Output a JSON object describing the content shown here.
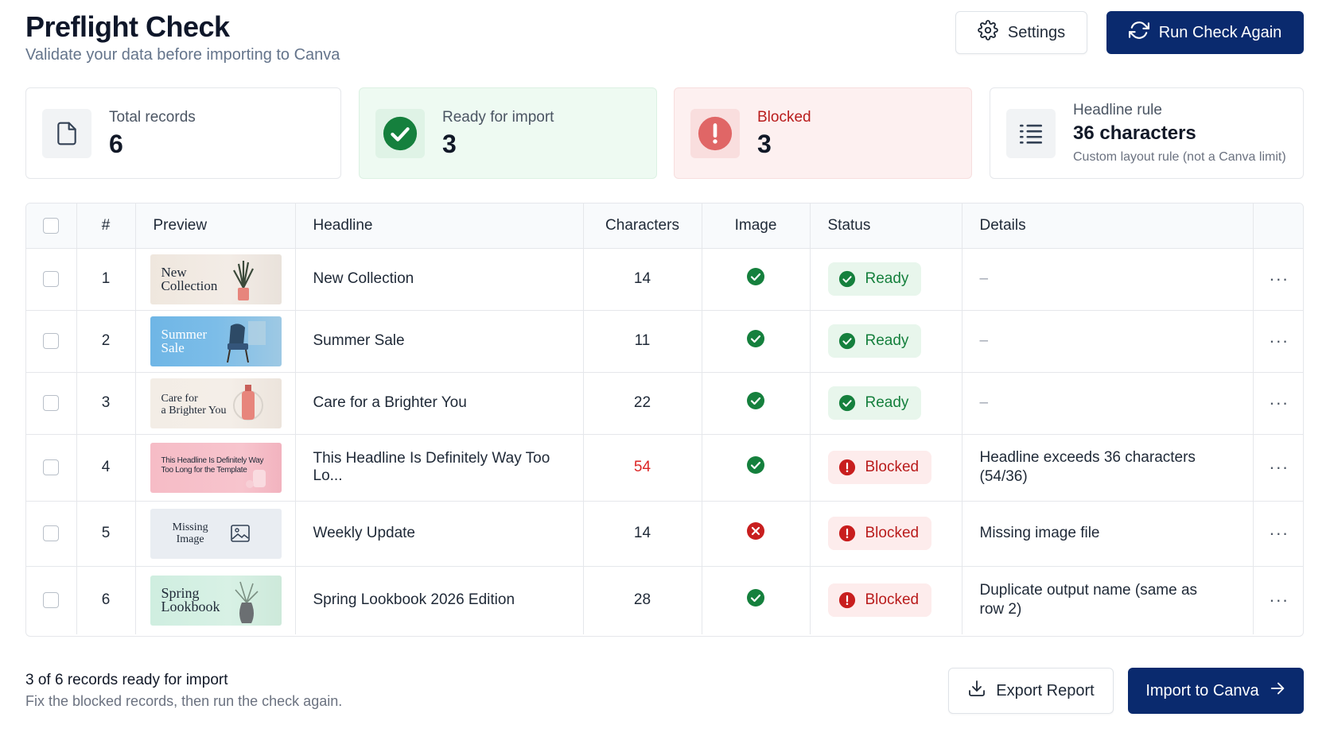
{
  "header": {
    "title": "Preflight Check",
    "subtitle": "Validate your data before importing to Canva",
    "settings_label": "Settings",
    "run_label": "Run Check Again"
  },
  "cards": {
    "total": {
      "label": "Total records",
      "value": "6"
    },
    "ready": {
      "label": "Ready for import",
      "value": "3"
    },
    "blocked": {
      "label": "Blocked",
      "value": "3"
    },
    "rule": {
      "label": "Headline rule",
      "value": "36 characters",
      "note": "Custom layout rule (not a Canva limit)"
    }
  },
  "table": {
    "headers": {
      "num": "#",
      "preview": "Preview",
      "headline": "Headline",
      "characters": "Characters",
      "image": "Image",
      "status": "Status",
      "details": "Details"
    },
    "rows": [
      {
        "num": "1",
        "preview_text": "New\nCollection",
        "headline": "New Collection",
        "characters": "14",
        "image_ok": true,
        "status": "Ready",
        "details": "–"
      },
      {
        "num": "2",
        "preview_text": "Summer\nSale",
        "headline": "Summer Sale",
        "characters": "11",
        "image_ok": true,
        "status": "Ready",
        "details": "–"
      },
      {
        "num": "3",
        "preview_text": "Care for\na Brighter You",
        "headline": "Care for a Brighter You",
        "characters": "22",
        "image_ok": true,
        "status": "Ready",
        "details": "–"
      },
      {
        "num": "4",
        "preview_text": "This Headline Is Definitely Way\nToo Long for the Template",
        "headline": "This Headline Is Definitely Way Too Lo...",
        "characters": "54",
        "image_ok": true,
        "status": "Blocked",
        "details": "Headline exceeds 36 characters (54/36)"
      },
      {
        "num": "5",
        "preview_text": "Missing\nImage",
        "headline": "Weekly Update",
        "characters": "14",
        "image_ok": false,
        "status": "Blocked",
        "details": "Missing image file"
      },
      {
        "num": "6",
        "preview_text": "Spring\nLookbook",
        "headline": "Spring Lookbook 2026 Edition",
        "characters": "28",
        "image_ok": true,
        "status": "Blocked",
        "details": "Duplicate output name (same as row 2)"
      }
    ],
    "menu_glyph": "···"
  },
  "footer": {
    "summary": "3 of 6 records ready for import",
    "hint": "Fix the blocked records, then run the check again.",
    "export_label": "Export Report",
    "import_label": "Import to Canva"
  },
  "colors": {
    "primary": "#0a2a6e",
    "ready": "#15803d",
    "blocked": "#b91c1c"
  }
}
